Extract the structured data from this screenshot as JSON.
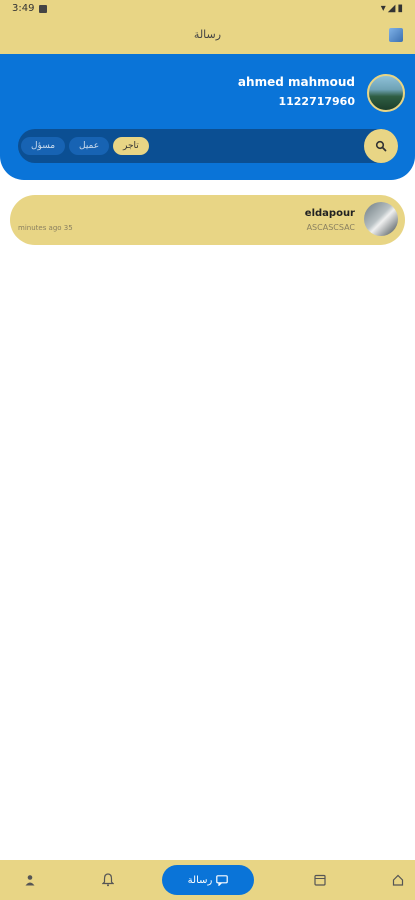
{
  "status_bar": {
    "time": "3:49"
  },
  "app_bar": {
    "title": "رسالة"
  },
  "profile": {
    "name": "ahmed mahmoud",
    "phone": "1122717960"
  },
  "filters": [
    {
      "label": "تاجر",
      "active": true
    },
    {
      "label": "عميل",
      "active": false
    },
    {
      "label": "مسؤل",
      "active": false
    }
  ],
  "conversations": [
    {
      "name": "eldapour",
      "preview": "ASCASCSAC",
      "time": "minutes ago 35"
    }
  ],
  "bottom_nav": {
    "active_label": "رسالة",
    "items": [
      "profile",
      "notifications",
      "messages",
      "orders",
      "home"
    ]
  },
  "colors": {
    "accent": "#0a74d8",
    "bar": "#e8d585",
    "panel": "#0b4f93"
  }
}
